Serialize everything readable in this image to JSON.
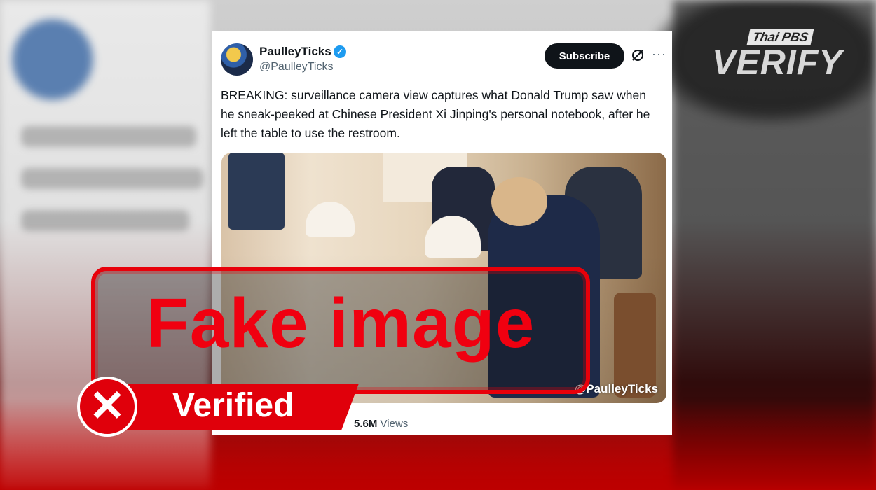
{
  "tweet": {
    "display_name": "PaulleyTicks",
    "handle": "@PaulleyTicks",
    "subscribe_label": "Subscribe",
    "more_glyph": "···",
    "text": "BREAKING: surveillance camera view captures what Donald Trump saw when he sneak-peeked at Chinese President Xi Jinping's personal notebook, after he left the table to use the restroom.",
    "media_watermark": "@PaulleyTicks",
    "views_count": "5.6M",
    "views_label": "Views"
  },
  "overlay": {
    "stamp_text": "Fake image",
    "verified_label": "Verified",
    "x_glyph": "✕"
  },
  "brand": {
    "top": "Thai PBS",
    "main": "VERIFY"
  },
  "colors": {
    "stamp_red": "#f00010",
    "subscribe_bg": "#0f1419",
    "verified_badge": "#1d9bf0"
  }
}
